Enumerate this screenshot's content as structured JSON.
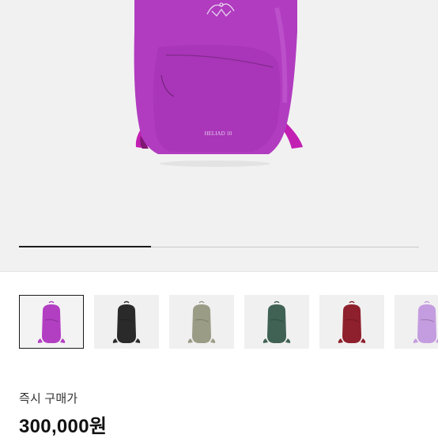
{
  "product": {
    "bag_label": "HELIAD 10",
    "image_progress": 0.33,
    "main_color": "#b03bbf",
    "strap_color": "#c21fb3"
  },
  "thumbnails": [
    {
      "color_name": "purple",
      "color": "#b23fc2",
      "selected": true
    },
    {
      "color_name": "black",
      "color": "#2a2a2a",
      "selected": false
    },
    {
      "color_name": "sage",
      "color": "#9a9c86",
      "selected": false
    },
    {
      "color_name": "green",
      "color": "#3f6255",
      "selected": false
    },
    {
      "color_name": "burgundy",
      "color": "#8e1f2c",
      "selected": false
    },
    {
      "color_name": "lavender",
      "color": "#c49ce0",
      "selected": false
    }
  ],
  "purchase": {
    "label": "즉시 구매가",
    "price": "300,000원"
  }
}
